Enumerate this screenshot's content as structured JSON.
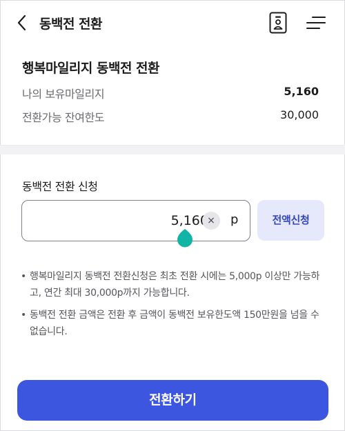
{
  "header": {
    "title": "동백전 전환",
    "back_icon": "chevron-left-icon",
    "id_card_icon": "id-card-icon",
    "menu_icon": "hamburger-menu-icon"
  },
  "conversion": {
    "title": "행복마일리지 동백전 전환",
    "rows": [
      {
        "label": "나의 보유마일리지",
        "value": "5,160"
      },
      {
        "label": "전환가능 잔여한도",
        "value": "30,000"
      }
    ]
  },
  "application": {
    "title": "동백전 전환 신청",
    "amount_value": "5,160",
    "clear_label": "×",
    "unit": "p",
    "full_amount_label": "전액신청"
  },
  "notices": [
    "행복마일리지 동백전 전환신청은 최초 전환 시에는 5,000p 이상만 가능하고, 연간 최대 30,000p까지 가능합니다.",
    "동백전 전환 금액은 전환 후 금액이 동백전 보유한도액 150만원을 넘을 수 없습니다."
  ],
  "notice_bullet": "•",
  "submit_label": "전환하기",
  "colors": {
    "primary": "#3d56e0",
    "caret_handle": "#12b4a6",
    "full_button_bg": "#e6e9fb",
    "divider_bg": "#f2f2f5"
  }
}
